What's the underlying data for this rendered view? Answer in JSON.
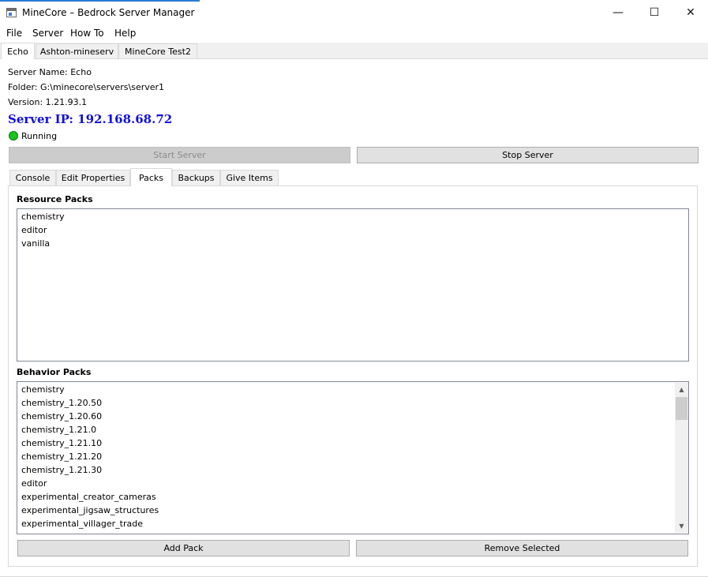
{
  "window": {
    "title": "MineCore – Bedrock Server Manager",
    "minimize_glyph": "—",
    "maximize_glyph": "☐",
    "close_glyph": "✕"
  },
  "menu": [
    "File",
    "Server",
    "How To",
    "Help"
  ],
  "server_tabs": [
    {
      "label": "Echo",
      "active": true
    },
    {
      "label": "Ashton-mineserv",
      "active": false
    },
    {
      "label": "MineCore Test2",
      "active": false
    }
  ],
  "info": {
    "server_name": "Server Name: Echo",
    "folder": "Folder: G:\\minecore\\servers\\server1",
    "version": "Version: 1.21.93.1",
    "server_ip": "Server IP: 192.168.68.72",
    "ip_color": "#1010e0",
    "status": "Running",
    "status_color": "#1ec21e"
  },
  "controls": {
    "start_label": "Start Server",
    "start_enabled": false,
    "stop_label": "Stop Server"
  },
  "inner_tabs": [
    {
      "label": "Console",
      "active": false
    },
    {
      "label": "Edit Properties",
      "active": false
    },
    {
      "label": "Packs",
      "active": true
    },
    {
      "label": "Backups",
      "active": false
    },
    {
      "label": "Give Items",
      "active": false
    }
  ],
  "packs": {
    "resource_title": "Resource Packs",
    "resource_items": [
      "chemistry",
      "editor",
      "vanilla"
    ],
    "behavior_title": "Behavior Packs",
    "behavior_items": [
      "chemistry",
      "chemistry_1.20.50",
      "chemistry_1.20.60",
      "chemistry_1.21.0",
      "chemistry_1.21.10",
      "chemistry_1.21.20",
      "chemistry_1.21.30",
      "editor",
      "experimental_creator_cameras",
      "experimental_jigsaw_structures",
      "experimental_villager_trade"
    ],
    "add_label": "Add Pack",
    "remove_label": "Remove Selected"
  },
  "icons": {
    "app": "app-window-icon",
    "status": "status-indicator-icon",
    "scroll_up": "▲",
    "scroll_down": "▼"
  }
}
